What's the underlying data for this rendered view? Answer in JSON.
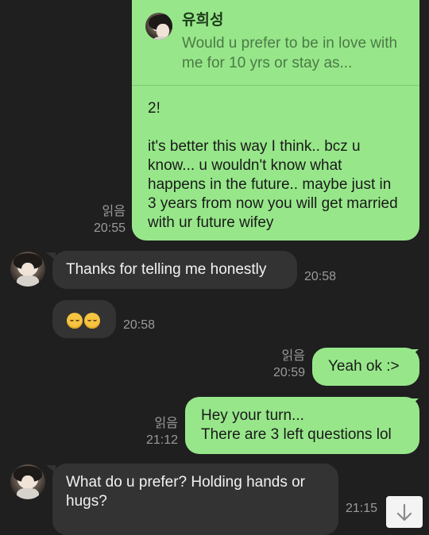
{
  "messages": {
    "reply": {
      "quoted_name": "유희성",
      "quoted_text": "Would u prefer to be in love with me for 10 yrs or stay as...",
      "body_line1": "2!",
      "body_text": "it's better this way I think.. bcz u know... u wouldn't know what happens in the future.. maybe just in 3 years from now you will get married with ur future wifey",
      "read": "읽음",
      "time": "20:55"
    },
    "m1": {
      "text": "Thanks for telling me honestly",
      "time": "20:58"
    },
    "m2": {
      "emoji_count": 2,
      "time": "20:58"
    },
    "m3": {
      "text": "Yeah ok :>",
      "read": "읽음",
      "time": "20:59"
    },
    "m4": {
      "line1": "Hey your turn...",
      "line2": "There are 3 left questions lol",
      "read": "읽음",
      "time": "21:12"
    },
    "m5": {
      "text": "What do u prefer? Holding hands or hugs?",
      "time": "21:15"
    }
  },
  "icons": {
    "avatar": "profile-avatar",
    "scroll": "arrow-down-icon"
  },
  "colors": {
    "background": "#1f1f1f",
    "outgoing_bubble": "#97e78a",
    "incoming_bubble": "#333333",
    "meta_text": "#9a9a9a"
  }
}
